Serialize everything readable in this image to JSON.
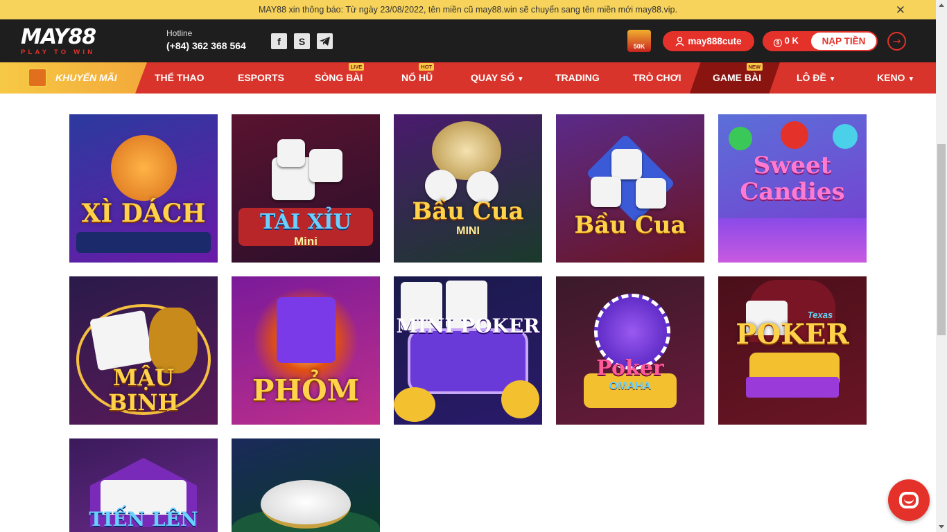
{
  "notice": {
    "text": "MAY88 xin thông báo: Từ ngày 23/08/2022, tên miền cũ may88.win sẽ chuyển sang tên miền mới may88.vip.",
    "close_icon": "close-icon"
  },
  "header": {
    "logo": {
      "main": "MAY88",
      "tagline": "PLAY TO WIN"
    },
    "hotline": {
      "label": "Hotline",
      "number": "(+84) 362 368 564"
    },
    "social": [
      "facebook-icon",
      "skype-icon",
      "telegram-icon"
    ],
    "promo_badge": "50K",
    "username": "may888cute",
    "balance": "0 K",
    "deposit_label": "NẠP TIỀN"
  },
  "nav": {
    "promo": "KHUYẾN MÃI",
    "items": [
      {
        "label": "THỂ THAO",
        "badge": ""
      },
      {
        "label": "ESPORTS",
        "badge": ""
      },
      {
        "label": "SÒNG BÀI",
        "badge": "LIVE"
      },
      {
        "label": "NỔ HŨ",
        "badge": "HOT"
      },
      {
        "label": "QUAY SỐ",
        "badge": ""
      },
      {
        "label": "TRADING",
        "badge": ""
      },
      {
        "label": "TRÒ CHƠI",
        "badge": ""
      },
      {
        "label": "GAME BÀI",
        "badge": "NEW"
      },
      {
        "label": "LÔ ĐỀ",
        "badge": ""
      },
      {
        "label": "KENO",
        "badge": ""
      }
    ]
  },
  "games": [
    {
      "title": "XÌ DÁCH",
      "subtitle": "",
      "bg": [
        "#2b3a9e",
        "#6a1aa8"
      ]
    },
    {
      "title": "TÀI XỈU",
      "subtitle": "Mini",
      "bg": [
        "#5a1330",
        "#2a0f2a"
      ]
    },
    {
      "title": "Bầu Cua",
      "subtitle": "MINI",
      "bg": [
        "#4a1a6e",
        "#1a3a2a"
      ]
    },
    {
      "title": "Bầu Cua",
      "subtitle": "",
      "bg": [
        "#5a2a8a",
        "#6a1520"
      ]
    },
    {
      "title": "Sweet Candies",
      "subtitle": "",
      "bg": [
        "#5b6fd8",
        "#7a3acf"
      ]
    },
    {
      "title": "MẬU BINH",
      "subtitle": "",
      "bg": [
        "#2a1a4a",
        "#5a1a5a"
      ]
    },
    {
      "title": "PHỎM",
      "subtitle": "",
      "bg": [
        "#7a1a9a",
        "#c0308a"
      ]
    },
    {
      "title": "MINI POKER",
      "subtitle": "",
      "bg": [
        "#1a1a4a",
        "#2a1a6a"
      ]
    },
    {
      "title": "Poker",
      "subtitle": "OMAHA",
      "bg": [
        "#3a1a2a",
        "#6a1a3a"
      ]
    },
    {
      "title": "POKER",
      "subtitle": "Texas",
      "bg": [
        "#4a0f1a",
        "#6a1525"
      ]
    },
    {
      "title": "TIẾN LÊN",
      "subtitle": "",
      "bg": [
        "#3a1a5a",
        "#6a2a8a"
      ]
    },
    {
      "title": "",
      "subtitle": "",
      "bg": [
        "#1a2a5a",
        "#0a3a2a"
      ]
    }
  ],
  "chat_icon": "chat-icon"
}
